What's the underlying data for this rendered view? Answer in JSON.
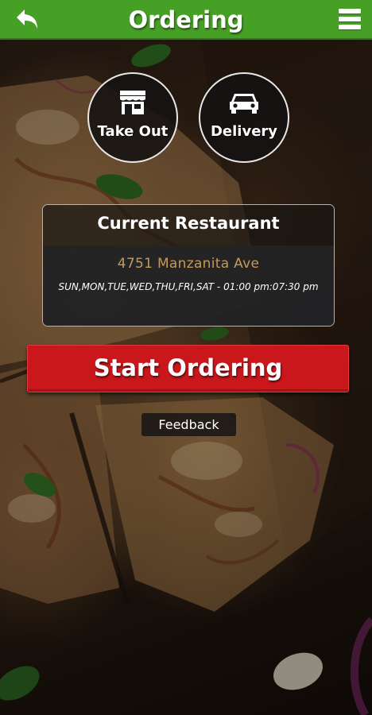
{
  "header": {
    "title": "Ordering",
    "back_icon": "back-arrow-icon",
    "menu_icon": "hamburger-menu-icon",
    "bar_color": "#47a026"
  },
  "modes": {
    "takeout": {
      "label": "Take Out",
      "icon": "storefront-icon"
    },
    "delivery": {
      "label": "Delivery",
      "icon": "car-icon"
    }
  },
  "restaurant_card": {
    "heading": "Current Restaurant",
    "address": "4751 Manzanita Ave",
    "hours": "SUN,MON,TUE,WED,THU,FRI,SAT - 01:00 pm:07:30 pm",
    "address_color": "#c49a5c"
  },
  "actions": {
    "start_ordering": "Start Ordering",
    "start_color": "#c9171c",
    "feedback": "Feedback"
  }
}
